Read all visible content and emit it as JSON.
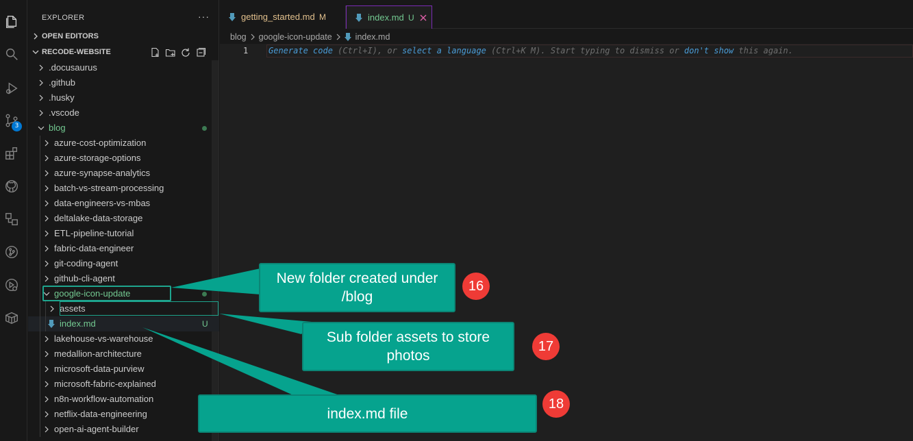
{
  "activity_bar": {
    "icons": [
      "explorer-icon",
      "search-icon",
      "run-debug-icon",
      "source-control-icon",
      "extensions-icon",
      "github-icon",
      "remote-explorer-icon",
      "git-graph-icon",
      "testing-icon",
      "containers-icon"
    ],
    "source_control_badge": "3"
  },
  "sidebar": {
    "title": "EXPLORER",
    "more": "···",
    "open_editors": "OPEN EDITORS",
    "project": "RECODE-WEBSITE",
    "items": [
      {
        "label": ".docusaurus"
      },
      {
        "label": ".github"
      },
      {
        "label": ".husky"
      },
      {
        "label": ".vscode"
      },
      {
        "label": "blog"
      },
      {
        "label": "azure-cost-optimization"
      },
      {
        "label": "azure-storage-options"
      },
      {
        "label": "azure-synapse-analytics"
      },
      {
        "label": "batch-vs-stream-processing"
      },
      {
        "label": "data-engineers-vs-mbas"
      },
      {
        "label": "deltalake-data-storage"
      },
      {
        "label": "ETL-pipeline-tutorial"
      },
      {
        "label": "fabric-data-engineer"
      },
      {
        "label": "git-coding-agent"
      },
      {
        "label": "github-cli-agent"
      },
      {
        "label": "google-icon-update"
      },
      {
        "label": "assets"
      },
      {
        "label": "index.md",
        "status": "U"
      },
      {
        "label": "lakehouse-vs-warehouse"
      },
      {
        "label": "medallion-architecture"
      },
      {
        "label": "microsoft-data-purview"
      },
      {
        "label": "microsoft-fabric-explained"
      },
      {
        "label": "n8n-workflow-automation"
      },
      {
        "label": "netflix-data-engineering"
      },
      {
        "label": "open-ai-agent-builder"
      }
    ]
  },
  "tabs": [
    {
      "label": "getting_started.md",
      "status": "M"
    },
    {
      "label": "index.md",
      "status": "U"
    }
  ],
  "breadcrumb": [
    "blog",
    "google-icon-update",
    "index.md"
  ],
  "editor": {
    "line_number": "1",
    "hint_parts": [
      {
        "text": "Generate code",
        "link": true
      },
      {
        "text": " (Ctrl+I), or ",
        "link": false
      },
      {
        "text": "select a language",
        "link": true
      },
      {
        "text": " (Ctrl+K M). Start typing to dismiss or ",
        "link": false
      },
      {
        "text": "don't show",
        "link": true
      },
      {
        "text": " this again.",
        "link": false
      }
    ]
  },
  "callouts": [
    {
      "text": "New folder created under /blog",
      "number": "16"
    },
    {
      "text": "Sub folder assets to store photos",
      "number": "17"
    },
    {
      "text": "index.md file",
      "number": "18"
    }
  ],
  "colors": {
    "accent_callout": "#06a38e",
    "number_badge": "#ef3b36",
    "untracked": "#73c991",
    "modified": "#e2c08d"
  }
}
